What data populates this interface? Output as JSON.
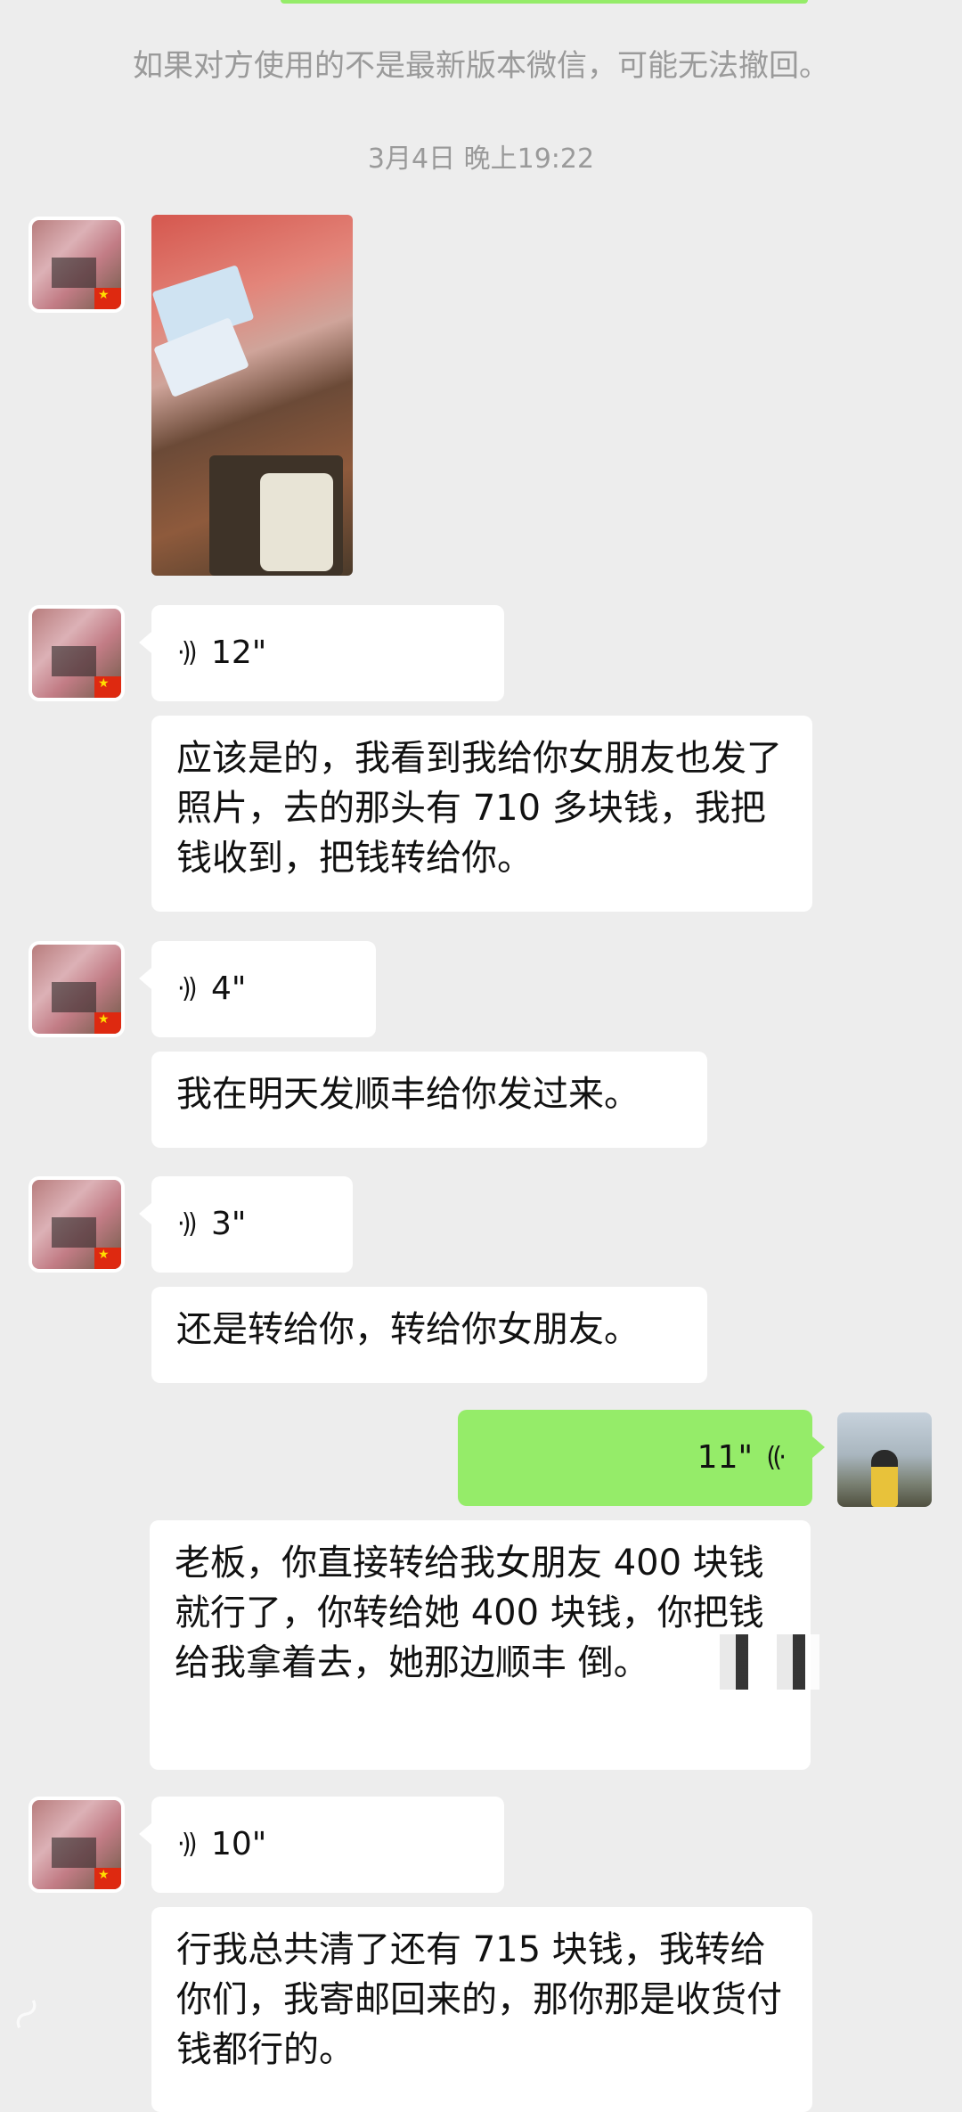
{
  "notice": "如果对方使用的不是最新版本微信，可能无法撤回。",
  "timestamp": "3月4日 晚上19:22",
  "messages": [
    {
      "type": "image"
    },
    {
      "type": "voice",
      "duration": "12\""
    },
    {
      "type": "text",
      "text": "应该是的，我看到我给你女朋友也发了照片，去的那头有 710 多块钱，我把钱收到，把钱转给你。"
    },
    {
      "type": "voice",
      "duration": "4\""
    },
    {
      "type": "text",
      "text": "我在明天发顺丰给你发过来。"
    },
    {
      "type": "voice",
      "duration": "3\""
    },
    {
      "type": "text",
      "text": "还是转给你，转给你女朋友。"
    },
    {
      "type": "voice",
      "duration": "11\"",
      "sender": "me"
    },
    {
      "type": "text",
      "text": "老板，你直接转给我女朋友 400 块钱就行了，你转给她 400 块钱，你把钱给我拿着去，她那边顺丰   倒。",
      "sender": "me"
    },
    {
      "type": "voice",
      "duration": "10\""
    },
    {
      "type": "text",
      "text": "行我总共清了还有 715 块钱，我转给你们，我寄邮回来的，那你那是收货付钱都行的。"
    }
  ],
  "icons": {
    "voice": "voice-wave-icon",
    "flag": "china-flag-icon"
  },
  "colors": {
    "background": "#ededed",
    "bubble_other": "#ffffff",
    "bubble_me": "#95ec69",
    "notice_text": "#9a9a9a"
  }
}
